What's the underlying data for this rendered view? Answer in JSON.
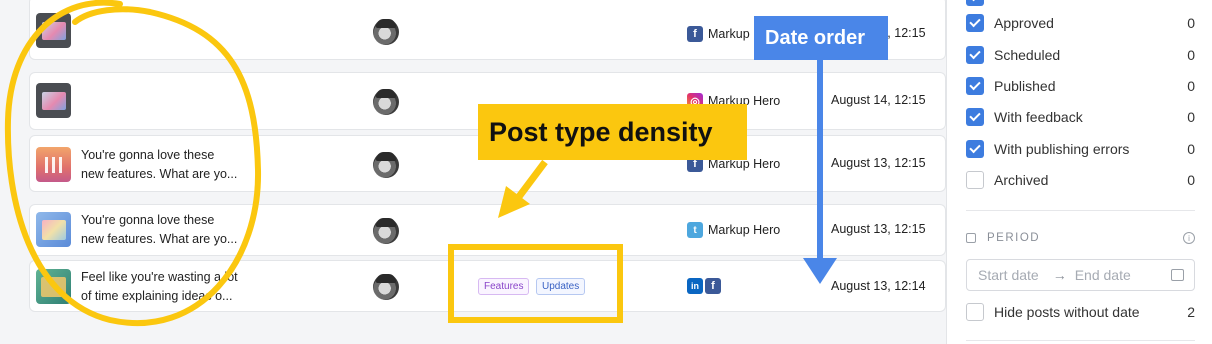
{
  "posts": [
    {
      "thumb": "dark",
      "caption_1": "",
      "caption_2": "",
      "network": "facebook",
      "account": "Markup",
      "date": "August 15, 12:15"
    },
    {
      "thumb": "dark",
      "caption_1": "",
      "caption_2": "",
      "network": "instagram",
      "account": "Markup Hero",
      "date": "August 14, 12:15"
    },
    {
      "thumb": "orange",
      "caption_1": "You're gonna love these",
      "caption_2": "new features. What are yo...",
      "network": "facebook",
      "account": "Markup Hero",
      "date": "August 13, 12:15"
    },
    {
      "thumb": "blue",
      "caption_1": "You're gonna love these",
      "caption_2": "new features. What are yo...",
      "network": "twitter",
      "account": "Markup Hero",
      "date": "August 13, 12:15"
    },
    {
      "thumb": "green",
      "caption_1": "Feel like you're wasting a lot",
      "caption_2": "of time explaining ideas o...",
      "network": "linkedin+facebook",
      "account": "",
      "date": "August 13, 12:14",
      "tags": [
        "Features",
        "Updates"
      ]
    }
  ],
  "network_icons": {
    "facebook": "f",
    "instagram": "◎",
    "twitter": "t",
    "linkedin": "in"
  },
  "filters": [
    {
      "label": "Approved",
      "checked": true,
      "count": "0"
    },
    {
      "label": "Scheduled",
      "checked": true,
      "count": "0"
    },
    {
      "label": "Published",
      "checked": true,
      "count": "0"
    },
    {
      "label": "With feedback",
      "checked": true,
      "count": "0"
    },
    {
      "label": "With publishing errors",
      "checked": true,
      "count": "0"
    },
    {
      "label": "Archived",
      "checked": false,
      "count": "0"
    }
  ],
  "period": {
    "heading": "PERIOD",
    "start_placeholder": "Start date",
    "arrow": "→",
    "end_placeholder": "End date",
    "info_icon": "i"
  },
  "hide_posts": {
    "label": "Hide posts without date",
    "checked": false,
    "count": "2"
  },
  "annotations": {
    "date_order": "Date order",
    "post_type_density": "Post type density",
    "yellow": "#fbc70f",
    "blue": "#4a86e8"
  }
}
